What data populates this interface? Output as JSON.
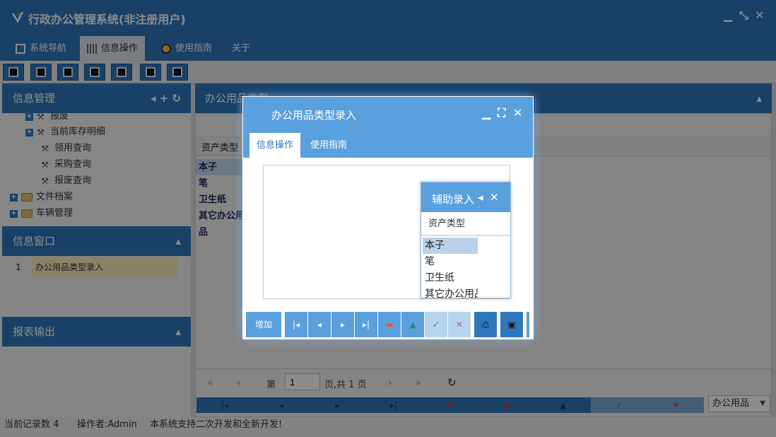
{
  "app": {
    "title": "行政办公管理系统(非注册用户)",
    "window_controls": [
      "minimize-icon",
      "restore-icon",
      "close-icon"
    ]
  },
  "menu": {
    "items": [
      {
        "label": "系统导航",
        "icon": "monitor-icon"
      },
      {
        "label": "信息操作",
        "icon": "grid-icon",
        "active": true
      },
      {
        "label": "使用指南",
        "icon": "help-icon"
      },
      {
        "label": "关于",
        "icon": ""
      }
    ]
  },
  "toolbar": {
    "buttons": [
      "search-tool-icon",
      "table-tool-icon",
      "doc-tool-icon",
      "users-tool-icon",
      "report-tool-icon",
      "export-tool-icon",
      "print-tool-icon"
    ]
  },
  "left": {
    "info_panel": {
      "title": "信息管理",
      "tree": [
        {
          "label": "报废",
          "level": 1,
          "expander": true,
          "icon": "tool-icon"
        },
        {
          "label": "当前库存明细",
          "level": 1,
          "expander": true,
          "icon": "tool-icon"
        },
        {
          "label": "领用查询",
          "level": 2,
          "icon": "tool-icon"
        },
        {
          "label": "采购查询",
          "level": 2,
          "icon": "tool-icon"
        },
        {
          "label": "报废查询",
          "level": 2,
          "icon": "tool-icon"
        },
        {
          "label": "文件档案",
          "level": 0,
          "expander": true,
          "icon": "folder-icon"
        },
        {
          "label": "车辆管理",
          "level": 0,
          "expander": true,
          "icon": "folder-icon"
        }
      ]
    },
    "window_panel": {
      "title": "信息窗口",
      "rows": [
        {
          "num": "1",
          "name": "办公用品类型录入"
        }
      ]
    },
    "report_panel": {
      "title": "报表输出"
    }
  },
  "main": {
    "title": "办公用品类型",
    "grid": {
      "column": "资产类型",
      "rows": [
        "本子",
        "笔",
        "卫生纸",
        "其它办公用品"
      ]
    },
    "pager": {
      "page_label": "第",
      "page_value": "1",
      "page_total": "页,共 1 页"
    },
    "combo_value": "办公用品"
  },
  "status": {
    "record_count": "当前记录数 4",
    "operator": "操作者:Admin",
    "note": "本系统支持二次开发和全新开发!"
  },
  "modal": {
    "title": "办公用品类型录入",
    "tabs": [
      "信息操作",
      "使用指南"
    ],
    "footer": {
      "add_label": "增加"
    }
  },
  "helper": {
    "title": "辅助录入",
    "column": "资产类型",
    "items": [
      "本子",
      "笔",
      "卫生纸",
      "其它办公用品"
    ]
  }
}
